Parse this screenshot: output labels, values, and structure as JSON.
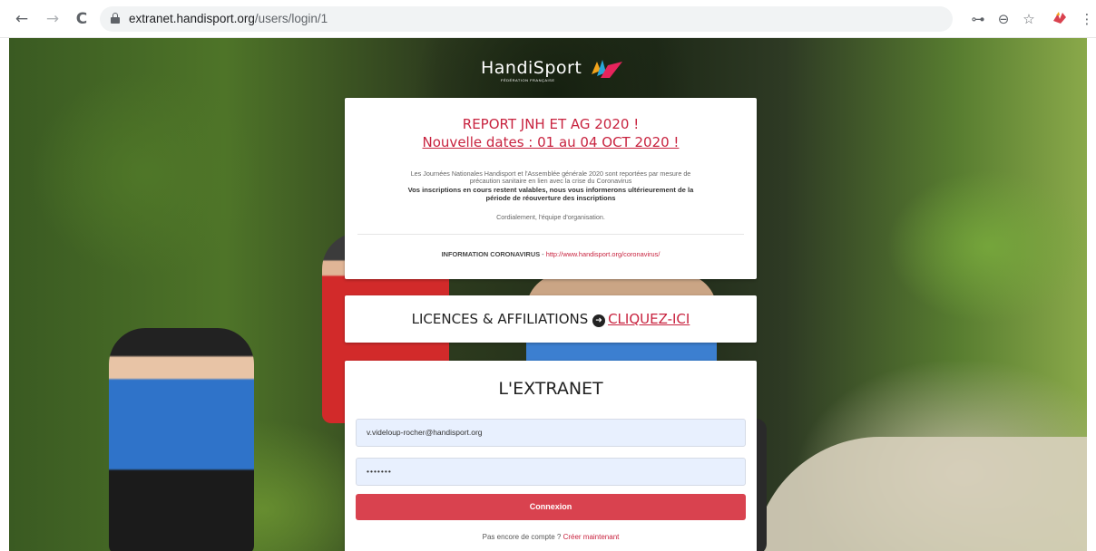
{
  "browser": {
    "back_icon": "←",
    "forward_icon": "→",
    "reload_icon": "C",
    "url_host": "extranet.handisport.org",
    "url_path": "/users/login/1",
    "key_icon": "⊶",
    "zoom_icon": "⊖",
    "star_icon": "☆",
    "menu_icon": "⋮"
  },
  "logo": {
    "text": "HandiSport",
    "subtitle": "FÉDÉRATION FRANÇAISE"
  },
  "notice": {
    "title_line1": "REPORT JNH ET AG 2020 !",
    "title_line2": "Nouvelle dates : 01 au 04 OCT 2020 !",
    "body_line1": "Les Journées Nationales Handisport et l'Assemblée générale 2020 sont reportées par mesure de",
    "body_line2": "précaution sanitaire en lien avec la crise du Coronavirus",
    "bold_line1": "Vos inscriptions en cours restent valables, nous vous informerons ultérieurement de la",
    "bold_line2": "période de réouverture des inscriptions",
    "signature": "Cordialement, l'équipe d'organisation.",
    "info_label": "INFORMATION CORONAVIRUS",
    "info_sep": " - ",
    "info_link": "http://www.handisport.org/coronavirus/"
  },
  "licences": {
    "label": "LICENCES & AFFILIATIONS",
    "arrow_icon": "➜",
    "link": "CLIQUEZ-ICI"
  },
  "login": {
    "title": "L'EXTRANET",
    "email_value": "v.videloup-rocher@handisport.org",
    "password_value": "•••••••",
    "submit_label": "Connexion",
    "signup_text": "Pas encore de compte ? ",
    "signup_link": "Créer maintenant"
  },
  "colors": {
    "accent": "#c8233f",
    "button": "#d9424f",
    "input_fill": "#e8f0fe"
  }
}
